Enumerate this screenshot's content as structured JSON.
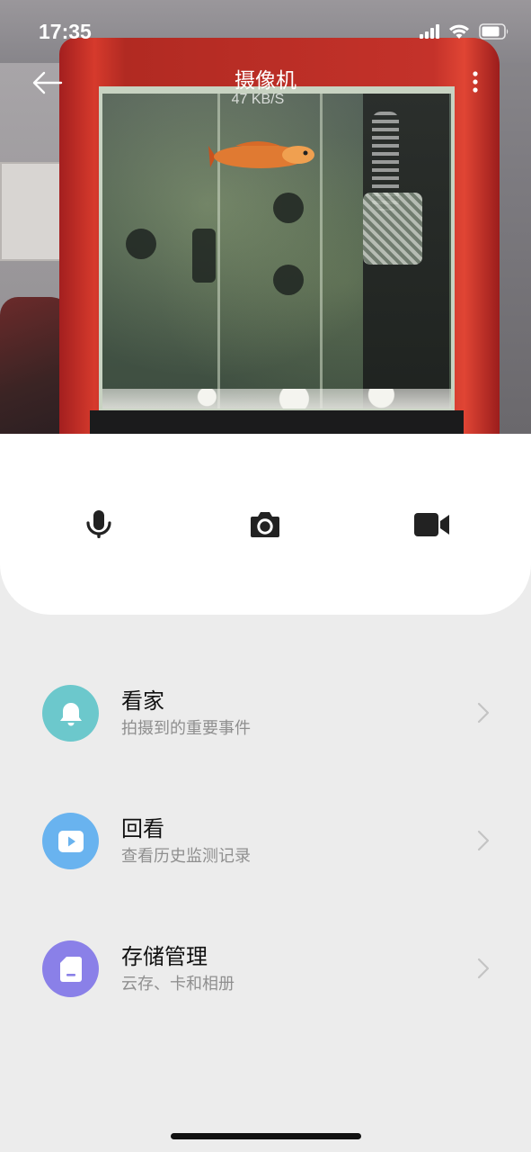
{
  "status_bar": {
    "time": "17:35"
  },
  "header": {
    "title": "摄像机",
    "bitrate": "47 KB/S"
  },
  "controls": [
    {
      "name": "microphone",
      "icon": "microphone-icon"
    },
    {
      "name": "snapshot",
      "icon": "camera-icon"
    },
    {
      "name": "record",
      "icon": "video-camera-icon"
    }
  ],
  "menu": [
    {
      "title": "看家",
      "subtitle": "拍摄到的重要事件",
      "icon": "bell-icon",
      "color": "#6cc8cc"
    },
    {
      "title": "回看",
      "subtitle": "查看历史监测记录",
      "icon": "play-icon",
      "color": "#69b3ef"
    },
    {
      "title": "存储管理",
      "subtitle": "云存、卡和相册",
      "icon": "sd-card-icon",
      "color": "#8a80e8"
    }
  ]
}
